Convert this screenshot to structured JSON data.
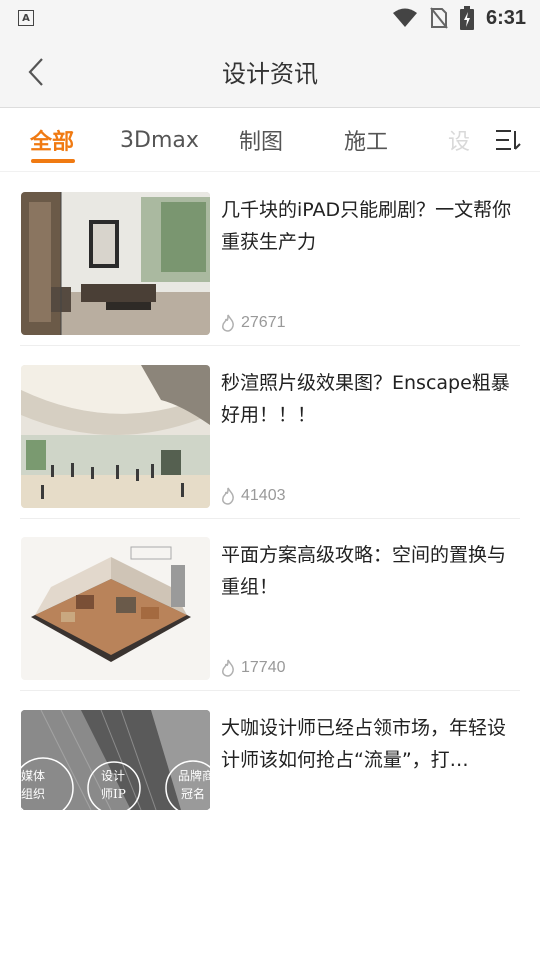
{
  "status_bar": {
    "time": "6:31",
    "left_icon": "accessibility-A-icon",
    "icons": [
      "wifi-icon",
      "no-sim-icon",
      "battery-charging-icon"
    ]
  },
  "header": {
    "title": "设计资讯",
    "back_icon": "chevron-left-icon"
  },
  "tabs": [
    {
      "label": "全部",
      "active": true
    },
    {
      "label": "3Dmax",
      "active": false
    },
    {
      "label": "制图",
      "active": false
    },
    {
      "label": "施工",
      "active": false
    },
    {
      "label": "设",
      "active": false
    }
  ],
  "tabs_menu_icon": "menu-lines-icon",
  "articles": [
    {
      "title": "几千块的iPAD只能刷剧？一文帮你重获生产力",
      "views": "27671",
      "image": "modern-living-room-photo"
    },
    {
      "title": "秒渲照片级效果图？Enscape粗暴好用！！！",
      "views": "41403",
      "image": "airport-terminal-render"
    },
    {
      "title": "平面方案高级攻略：空间的置换与重组！",
      "views": "17740",
      "image": "apartment-cutaway-render"
    },
    {
      "title": "大咖设计师已经占领市场，年轻设计师该如何抢占“流量”，打…",
      "views": "",
      "image": "dark-building-circles",
      "thumb_texts": [
        "媒体",
        "组织",
        "设计",
        "师IP",
        "品牌商",
        "冠名"
      ]
    }
  ],
  "colors": {
    "accent": "#f07a12",
    "header_bg": "#f5f5f5",
    "meta_gray": "#999999"
  }
}
